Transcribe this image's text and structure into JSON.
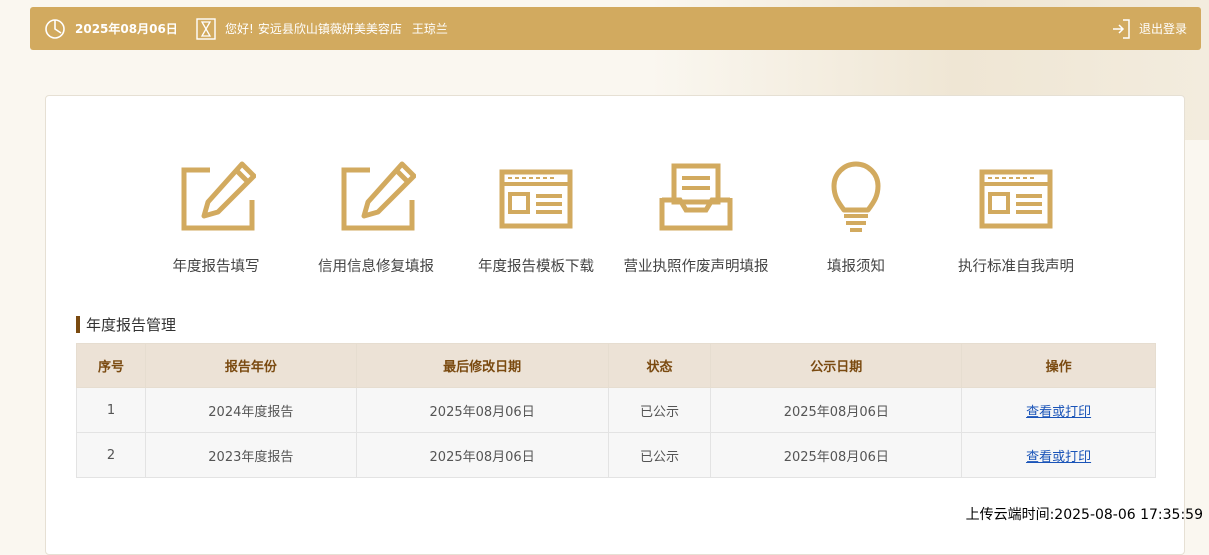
{
  "header": {
    "date": "2025年08月06日",
    "greeting": "您好!",
    "shop": "安远县欣山镇薇妍美美容店",
    "user": "王琼兰",
    "logout": "退出登录",
    "icons": [
      "clock-icon",
      "hourglass-icon",
      "logout-icon"
    ]
  },
  "nav": {
    "items": [
      {
        "label": "年度报告填写",
        "icon": "edit-icon"
      },
      {
        "label": "信用信息修复填报",
        "icon": "edit-icon"
      },
      {
        "label": "年度报告模板下载",
        "icon": "template-icon"
      },
      {
        "label": "营业执照作废声明填报",
        "icon": "inbox-icon"
      },
      {
        "label": "填报须知",
        "icon": "lightbulb-icon"
      },
      {
        "label": "执行标准自我声明",
        "icon": "template-icon"
      }
    ]
  },
  "section": {
    "title": "年度报告管理"
  },
  "table": {
    "headers": [
      "序号",
      "报告年份",
      "最后修改日期",
      "状态",
      "公示日期",
      "操作"
    ],
    "rows": [
      {
        "index": "1",
        "year": "2024年度报告",
        "modified": "2025年08月06日",
        "status": "已公示",
        "published": "2025年08月06日",
        "action": "查看或打印"
      },
      {
        "index": "2",
        "year": "2023年度报告",
        "modified": "2025年08月06日",
        "status": "已公示",
        "published": "2025年08月06日",
        "action": "查看或打印"
      }
    ]
  },
  "footer": {
    "upload_time": "上传云端时间:2025-08-06 17:35:59"
  },
  "colors": {
    "accent": "#d2aa5f",
    "title_bar": "#7a4a10",
    "link": "#1a54b8"
  }
}
